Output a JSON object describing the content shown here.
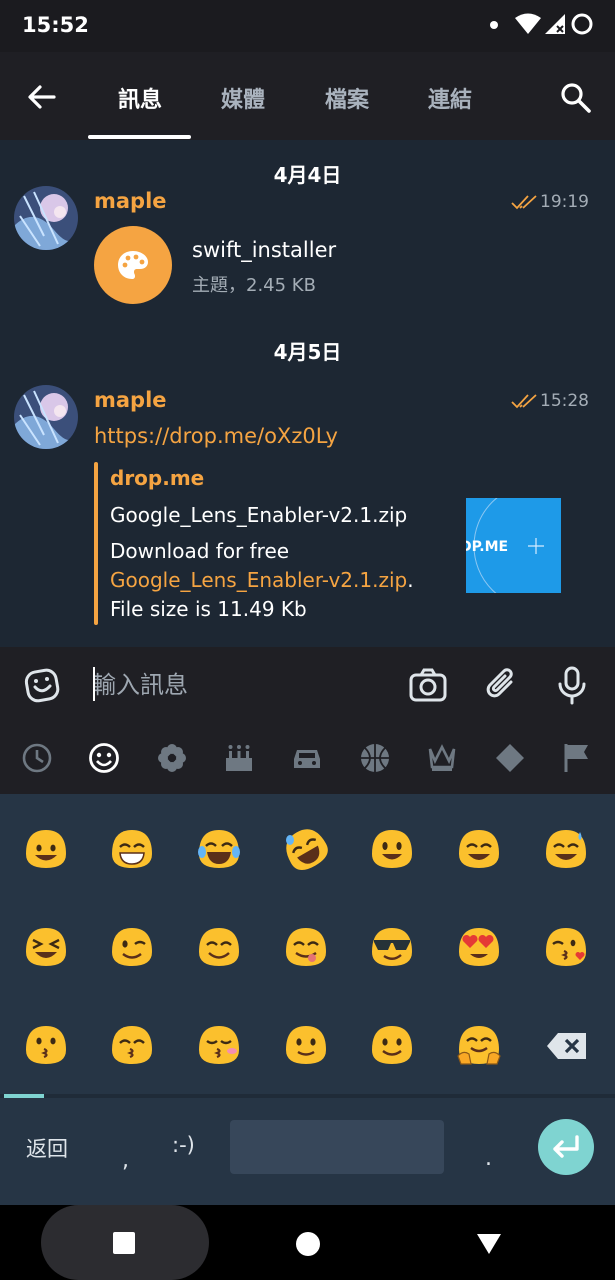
{
  "status_bar": {
    "time": "15:52"
  },
  "header": {
    "tabs": [
      {
        "label": "訊息",
        "active": true
      },
      {
        "label": "媒體",
        "active": false
      },
      {
        "label": "檔案",
        "active": false
      },
      {
        "label": "連結",
        "active": false
      }
    ]
  },
  "messages": {
    "date_1": "4月4日",
    "msg_1": {
      "sender": "maple",
      "time": "19:19",
      "file_name": "swift_installer",
      "file_meta": "主題，2.45 KB",
      "file_icon": "palette-icon"
    },
    "date_2": "4月5日",
    "msg_2": {
      "sender": "maple",
      "time": "15:28",
      "link": "https://drop.me/oXz0Ly",
      "preview": {
        "site": "drop.me",
        "title": "Google_Lens_Enabler-v2.1.zip",
        "desc_line1": "Download for free",
        "desc_link": "Google_Lens_Enabler-v2.1.zip",
        "desc_suffix": ".",
        "desc_line3": "File size is 11.49 Kb",
        "thumb_text": "DP.ME"
      }
    }
  },
  "input_bar": {
    "placeholder": "輸入訊息"
  },
  "emoji_categories": [
    "recent-icon",
    "smiley-icon",
    "flower-icon",
    "cake-icon",
    "car-icon",
    "basketball-icon",
    "crown-icon",
    "diamond-icon",
    "flag-icon"
  ],
  "emoji_grid": {
    "rows": [
      [
        "😀",
        "😁",
        "😂",
        "🤣",
        "😃",
        "😄",
        "😅"
      ],
      [
        "😆",
        "😉",
        "😊",
        "😋",
        "😎",
        "😍",
        "😘"
      ],
      [
        "😗",
        "😙",
        "😚",
        "🙂",
        "☺",
        "🤗"
      ]
    ]
  },
  "keyboard": {
    "back_label": "返回",
    "comma": ",",
    "smiley": ":-)",
    "period": "."
  },
  "colors": {
    "accent": "#f5a442",
    "background": "#1d2733",
    "keyboard": "#263545",
    "enter": "#7fd4d1"
  }
}
